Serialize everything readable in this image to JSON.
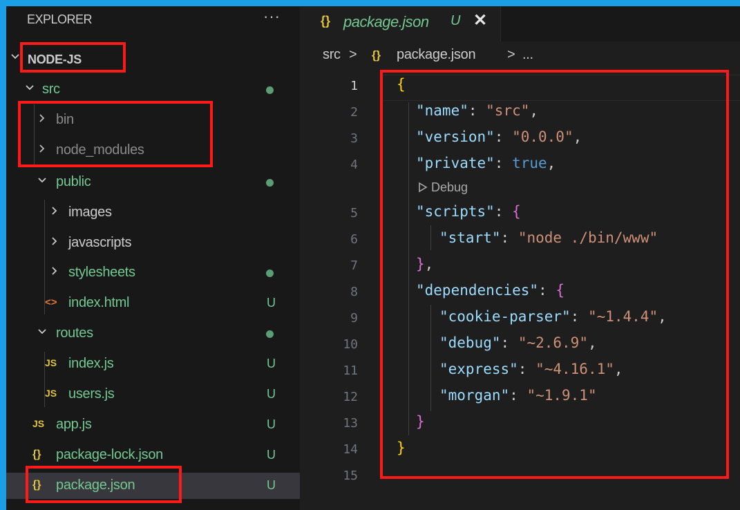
{
  "explorer": {
    "title": "EXPLORER",
    "more": "···",
    "root_label": "NODE-JS",
    "tree": [
      {
        "label": "src",
        "kind": "folder-open",
        "color": "#73c991",
        "status": "dot"
      },
      {
        "label": "bin",
        "kind": "folder-closed",
        "color": "#8b8b8b",
        "status": ""
      },
      {
        "label": "node_modules",
        "kind": "folder-closed",
        "color": "#8b8b8b",
        "status": ""
      },
      {
        "label": "public",
        "kind": "folder-open",
        "color": "#73c991",
        "status": "dot"
      },
      {
        "label": "images",
        "kind": "folder-closed",
        "color": "#cccccc",
        "status": ""
      },
      {
        "label": "javascripts",
        "kind": "folder-closed",
        "color": "#cccccc",
        "status": ""
      },
      {
        "label": "stylesheets",
        "kind": "folder-closed",
        "color": "#73c991",
        "status": "dot"
      },
      {
        "label": "index.html",
        "kind": "file-html",
        "color": "#73c991",
        "status": "U"
      },
      {
        "label": "routes",
        "kind": "folder-open",
        "color": "#73c991",
        "status": "dot"
      },
      {
        "label": "index.js",
        "kind": "file-js",
        "color": "#73c991",
        "status": "U"
      },
      {
        "label": "users.js",
        "kind": "file-js",
        "color": "#73c991",
        "status": "U"
      },
      {
        "label": "app.js",
        "kind": "file-js",
        "color": "#73c991",
        "status": "U"
      },
      {
        "label": "package-lock.json",
        "kind": "file-json",
        "color": "#73c991",
        "status": "U"
      },
      {
        "label": "package.json",
        "kind": "file-json",
        "color": "#73c991",
        "status": "U"
      }
    ]
  },
  "icons": {
    "html_glyph": "<>",
    "js_glyph": "JS",
    "json_glyph": "{}"
  },
  "editor": {
    "tab": {
      "title": "package.json",
      "badge": "U",
      "close": "✕"
    },
    "breadcrumb": {
      "folder": "src",
      "sep": ">",
      "file": "package.json",
      "tail": "..."
    },
    "codelens": "Debug",
    "line_numbers": [
      "1",
      "2",
      "3",
      "4",
      "5",
      "6",
      "7",
      "8",
      "9",
      "10",
      "11",
      "12",
      "13",
      "14",
      "15"
    ],
    "json": {
      "open": "{",
      "close": "}",
      "name_key": "\"name\"",
      "name_val": "\"src\"",
      "version_key": "\"version\"",
      "version_val": "\"0.0.0\"",
      "private_key": "\"private\"",
      "private_val": "true",
      "scripts_key": "\"scripts\"",
      "start_key": "\"start\"",
      "start_val": "\"node ./bin/www\"",
      "deps_key": "\"dependencies\"",
      "cookie_key": "\"cookie-parser\"",
      "cookie_val": "\"~1.4.4\"",
      "debug_key": "\"debug\"",
      "debug_val": "\"~2.6.9\"",
      "express_key": "\"express\"",
      "express_val": "\"~4.16.1\"",
      "morgan_key": "\"morgan\"",
      "morgan_val": "\"~1.9.1\""
    }
  },
  "colors": {
    "accent_frame": "#1a9ee5",
    "annotation_red": "#ff1a1a",
    "git_untracked": "#73c991"
  }
}
